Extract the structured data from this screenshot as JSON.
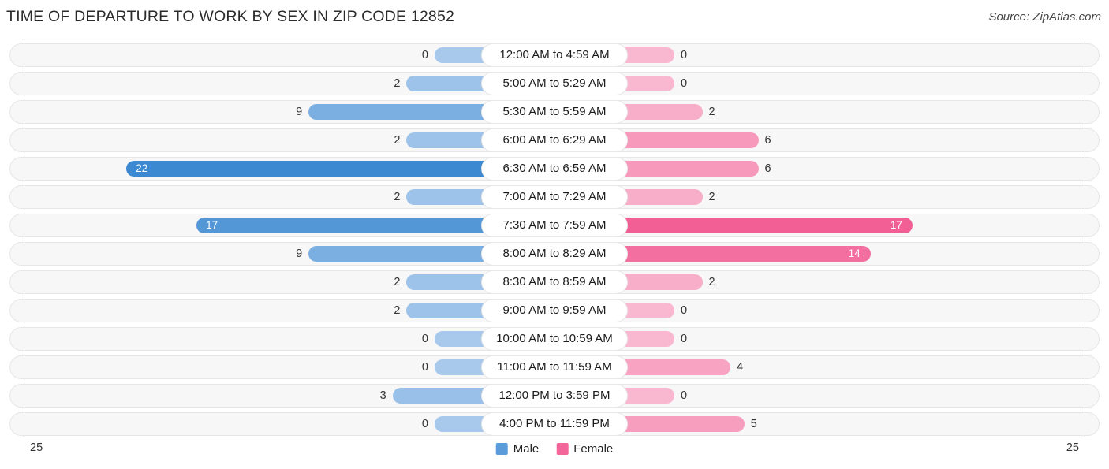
{
  "header": {
    "title": "TIME OF DEPARTURE TO WORK BY SEX IN ZIP CODE 12852",
    "source": "Source: ZipAtlas.com"
  },
  "legend": {
    "items": [
      {
        "label": "Male",
        "color": "#5b9bd9"
      },
      {
        "label": "Female",
        "color": "#f2669a"
      }
    ]
  },
  "axis": {
    "left_max": "25",
    "right_max": "25"
  },
  "chart_data": {
    "type": "bar",
    "subtype": "diverging-bar",
    "title": "TIME OF DEPARTURE TO WORK BY SEX IN ZIP CODE 12852",
    "xlabel": "",
    "ylabel": "",
    "xlim": [
      0,
      25
    ],
    "grid": false,
    "legend_position": "bottom-center",
    "categories": [
      "12:00 AM to 4:59 AM",
      "5:00 AM to 5:29 AM",
      "5:30 AM to 5:59 AM",
      "6:00 AM to 6:29 AM",
      "6:30 AM to 6:59 AM",
      "7:00 AM to 7:29 AM",
      "7:30 AM to 7:59 AM",
      "8:00 AM to 8:29 AM",
      "8:30 AM to 8:59 AM",
      "9:00 AM to 9:59 AM",
      "10:00 AM to 10:59 AM",
      "11:00 AM to 11:59 AM",
      "12:00 PM to 3:59 PM",
      "4:00 PM to 11:59 PM"
    ],
    "series": [
      {
        "name": "Male",
        "values": [
          0,
          2,
          9,
          2,
          22,
          2,
          17,
          9,
          2,
          2,
          0,
          0,
          3,
          0
        ]
      },
      {
        "name": "Female",
        "values": [
          0,
          0,
          2,
          6,
          6,
          2,
          17,
          14,
          2,
          0,
          0,
          4,
          0,
          5
        ]
      }
    ]
  },
  "rows": [
    {
      "category": "12:00 AM to 4:59 AM",
      "male": "0",
      "female": "0"
    },
    {
      "category": "5:00 AM to 5:29 AM",
      "male": "2",
      "female": "0"
    },
    {
      "category": "5:30 AM to 5:59 AM",
      "male": "9",
      "female": "2"
    },
    {
      "category": "6:00 AM to 6:29 AM",
      "male": "2",
      "female": "6"
    },
    {
      "category": "6:30 AM to 6:59 AM",
      "male": "22",
      "female": "6"
    },
    {
      "category": "7:00 AM to 7:29 AM",
      "male": "2",
      "female": "2"
    },
    {
      "category": "7:30 AM to 7:59 AM",
      "male": "17",
      "female": "17"
    },
    {
      "category": "8:00 AM to 8:29 AM",
      "male": "9",
      "female": "14"
    },
    {
      "category": "8:30 AM to 8:59 AM",
      "male": "2",
      "female": "2"
    },
    {
      "category": "9:00 AM to 9:59 AM",
      "male": "2",
      "female": "0"
    },
    {
      "category": "10:00 AM to 10:59 AM",
      "male": "0",
      "female": "0"
    },
    {
      "category": "11:00 AM to 11:59 AM",
      "male": "0",
      "female": "4"
    },
    {
      "category": "12:00 PM to 3:59 PM",
      "male": "3",
      "female": "0"
    },
    {
      "category": "4:00 PM to 11:59 PM",
      "male": "0",
      "female": "5"
    }
  ]
}
